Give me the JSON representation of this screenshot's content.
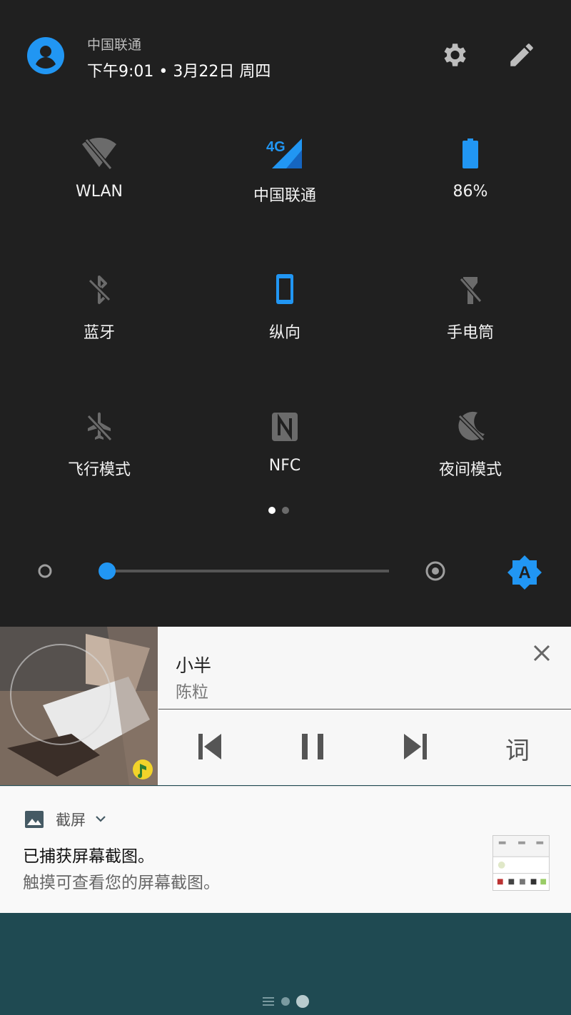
{
  "status": {
    "carrier": "中国联通",
    "datetime": "下午9:01 • 3月22日 周四"
  },
  "tiles": [
    {
      "label": "WLAN",
      "icon": "wifi-off-icon",
      "active": false
    },
    {
      "label": "中国联通",
      "icon": "4g-signal-icon",
      "active": true
    },
    {
      "label": "86%",
      "icon": "battery-icon",
      "active": true
    },
    {
      "label": "蓝牙",
      "icon": "bluetooth-off-icon",
      "active": false
    },
    {
      "label": "纵向",
      "icon": "portrait-icon",
      "active": true
    },
    {
      "label": "手电筒",
      "icon": "flashlight-off-icon",
      "active": false
    },
    {
      "label": "飞行模式",
      "icon": "airplane-off-icon",
      "active": false
    },
    {
      "label": "NFC",
      "icon": "nfc-icon",
      "active": false
    },
    {
      "label": "夜间模式",
      "icon": "night-mode-off-icon",
      "active": false
    }
  ],
  "signal_badge": "4G",
  "brightness": {
    "level": 0.02,
    "auto_label": "A"
  },
  "page_indicator": {
    "current": 1,
    "total": 2
  },
  "media": {
    "song": "小半",
    "artist": "陈粒",
    "lyrics_label": "词"
  },
  "notification": {
    "app": "截屏",
    "title": "已捕获屏幕截图。",
    "text": "触摸可查看您的屏幕截图。"
  },
  "colors": {
    "accent": "#2196f3",
    "shade": "#202020",
    "inactive_icon": "#6b6b6b",
    "card": "#f7f7f7"
  }
}
